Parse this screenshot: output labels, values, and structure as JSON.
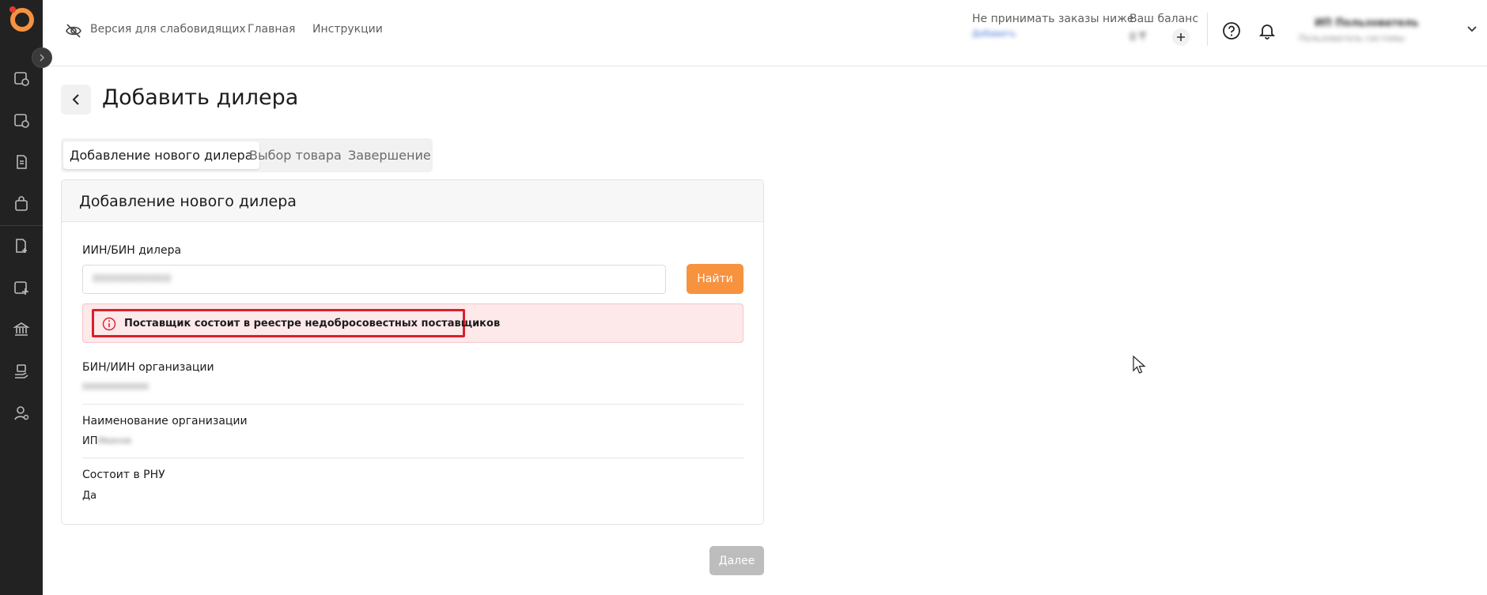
{
  "header": {
    "accessibility_label": "Версия для слабовидящих",
    "home_label": "Главная",
    "instructions_label": "Инструкции",
    "min_order_label": "Не принимать заказы ниже",
    "min_order_link": "Добавить",
    "balance_label": "Ваш баланс",
    "balance_value": "0 ₸",
    "user_name": "ИП Пользователь",
    "user_sub": "Пользователь системы"
  },
  "page": {
    "title": "Добавить дилера"
  },
  "tabs": [
    {
      "label": "Добавление нового дилера",
      "active": true
    },
    {
      "label": "Выбор товара",
      "active": false
    },
    {
      "label": "Завершение",
      "active": false
    }
  ],
  "card": {
    "title": "Добавление нового дилера",
    "iin_label": "ИИН/БИН дилера",
    "iin_value": "000000000000",
    "find_button": "Найти",
    "alert_text": "Поставщик состоит в реестре недобросовестных поставщиков",
    "fields": [
      {
        "label": "БИН/ИИН организации",
        "value": "000000000000"
      },
      {
        "label": "Наименование организации",
        "prefix": "ИП",
        "value": "Иванов"
      },
      {
        "label": "Состоит в РНУ",
        "value": "Да"
      }
    ]
  },
  "footer": {
    "next_button": "Далее"
  },
  "colors": {
    "accent": "#f7923f",
    "sidebar": "#222222",
    "alert_bg": "#fde8ea",
    "alert_border": "#d8202c"
  }
}
